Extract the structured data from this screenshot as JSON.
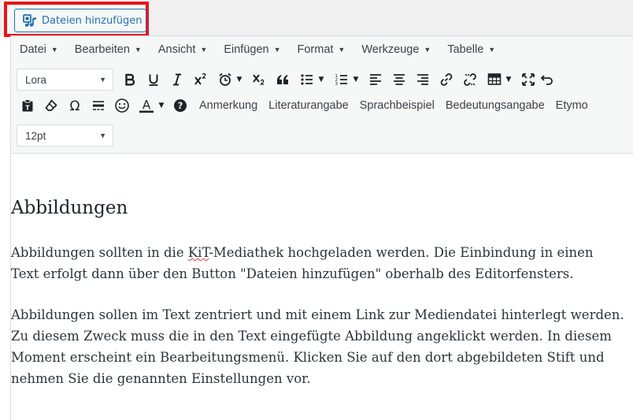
{
  "media_button": {
    "label": "Dateien hinzufügen",
    "icon": "add-media-icon"
  },
  "menubar": [
    {
      "label": "Datei"
    },
    {
      "label": "Bearbeiten"
    },
    {
      "label": "Ansicht"
    },
    {
      "label": "Einfügen"
    },
    {
      "label": "Format"
    },
    {
      "label": "Werkzeuge"
    },
    {
      "label": "Tabelle"
    }
  ],
  "toolbar": {
    "font_family": "Lora",
    "font_size": "12pt",
    "custom_buttons": [
      "Anmerkung",
      "Literaturangabe",
      "Sprachbeispiel",
      "Bedeutungsangabe",
      "Etymo"
    ]
  },
  "content": {
    "heading": "Abbildungen",
    "p1_before": "Abbildungen sollten in die ",
    "p1_marked": "KiT",
    "p1_after": "-Mediathek hochgeladen werden. Die Einbindung in einen Text erfolgt dann über den Button \"Dateien hinzufügen\" oberhalb des Editorfensters.",
    "p2": "Abbildungen sollen im Text zentriert und mit einem Link zur Mediendatei hinterlegt werden. Zu diesem Zweck muss die in den Text eingefügte Abbildung angeklickt werden. In diesem Moment erscheint ein Bearbeitungsmenü. Klicken Sie auf den dort abgebildeten Stift und nehmen Sie die genannten Einstellungen vor."
  },
  "colors": {
    "highlight": "#e8141a",
    "accent": "#2271b1"
  }
}
